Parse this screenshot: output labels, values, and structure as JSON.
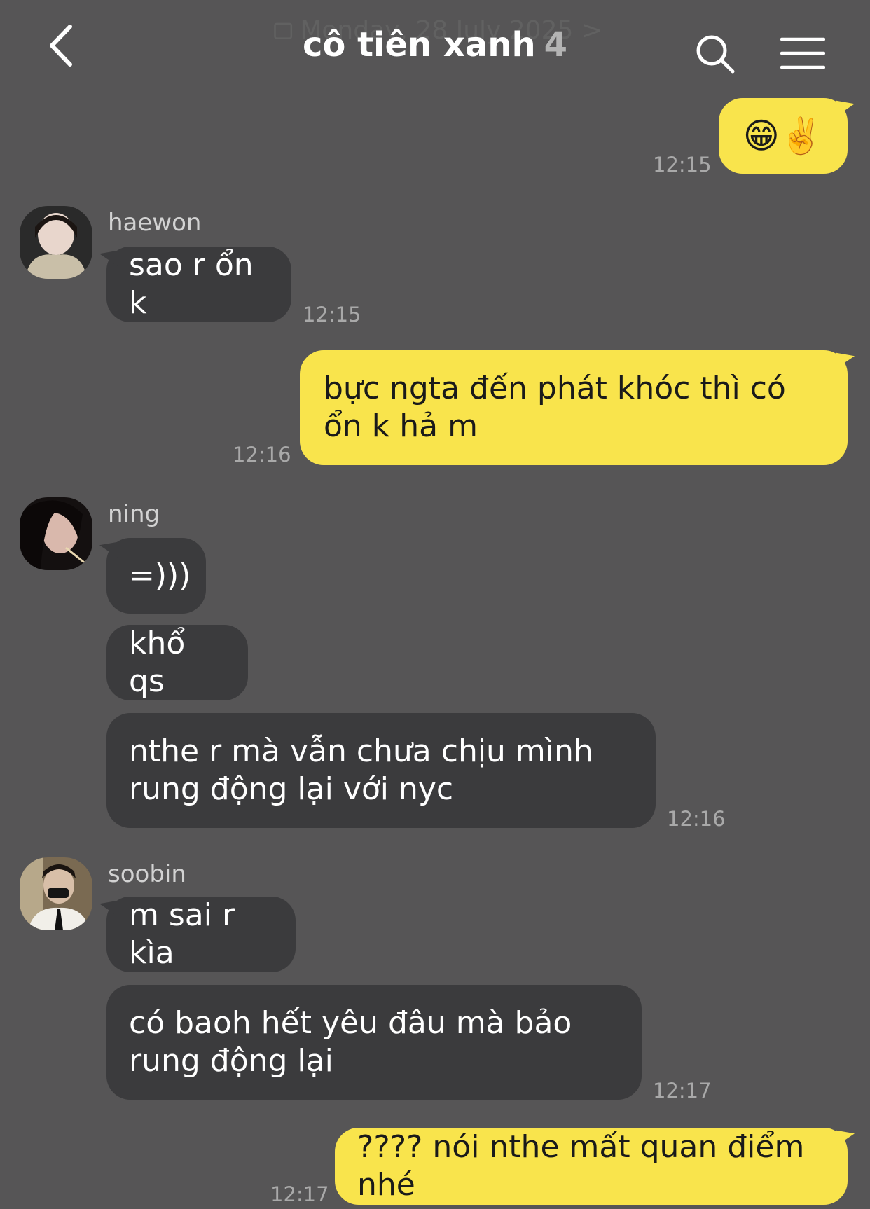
{
  "header": {
    "title": "cô tiên xanh",
    "member_count": "4",
    "date_ghost": "Monday, 28 July 2025 >"
  },
  "messages": [
    {
      "text": "😁✌️",
      "time": "12:15"
    },
    {
      "sender": "haewon",
      "text": "sao r ổn k",
      "time": "12:15"
    },
    {
      "text": "bực ngta đến phát khóc thì có ổn k hả m",
      "time": "12:16"
    },
    {
      "sender": "ning",
      "texts": [
        "=)))",
        "khổ qs",
        "nthe r mà vẫn chưa chịu mình rung động lại với nyc"
      ],
      "time": "12:16"
    },
    {
      "sender": "soobin",
      "texts": [
        "m sai r kìa",
        "có baoh hết yêu đâu mà bảo rung động lại"
      ],
      "time": "12:17"
    },
    {
      "text": "???? nói nthe mất quan điểm nhé",
      "time": "12:17"
    }
  ],
  "colors": {
    "background": "#565556",
    "incoming_bubble": "#3b3b3d",
    "outgoing_bubble": "#f9e44c"
  },
  "icons": {
    "back": "chevron-left-icon",
    "search": "search-icon",
    "menu": "hamburger-menu-icon",
    "calendar": "calendar-icon"
  }
}
